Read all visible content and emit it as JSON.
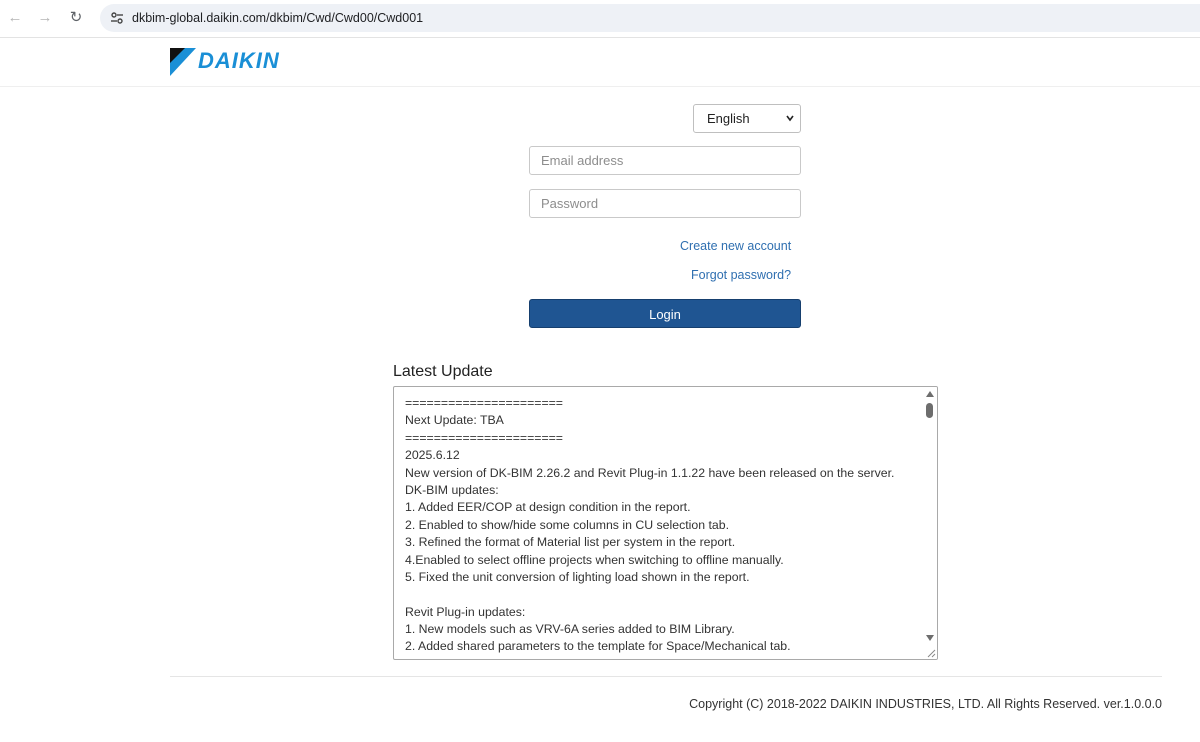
{
  "browser": {
    "url": "dkbim-global.daikin.com/dkbim/Cwd/Cwd00/Cwd001"
  },
  "header": {
    "logo_text": "DAIKIN",
    "brand_color": "#1a8fd6"
  },
  "login": {
    "language_selected": "English",
    "email_placeholder": "Email address",
    "password_placeholder": "Password",
    "create_account_label": "Create new account",
    "forgot_password_label": "Forgot password?",
    "login_label": "Login",
    "button_color": "#1f5592"
  },
  "updates": {
    "title": "Latest Update",
    "lines": [
      "======================",
      "Next Update: TBA",
      "======================",
      "2025.6.12",
      "New version of DK-BIM 2.26.2 and Revit Plug-in 1.1.22 have been released on the server.",
      "DK-BIM updates:",
      "1. Added EER/COP at design condition in the report.",
      "2. Enabled to show/hide some columns in CU selection tab.",
      "3. Refined the format of Material list per system in the report.",
      "4.Enabled to select offline projects when switching to offline manually.",
      "5. Fixed the unit conversion of lighting load shown in the report.",
      "",
      "Revit Plug-in updates:",
      "1. New models such as VRV-6A series added to BIM Library.",
      "2. Added shared parameters to the template for Space/Mechanical tab."
    ]
  },
  "footer": {
    "copyright": "Copyright (C) 2018-2022 DAIKIN INDUSTRIES, LTD. All Rights Reserved. ver.1.0.0.0"
  }
}
